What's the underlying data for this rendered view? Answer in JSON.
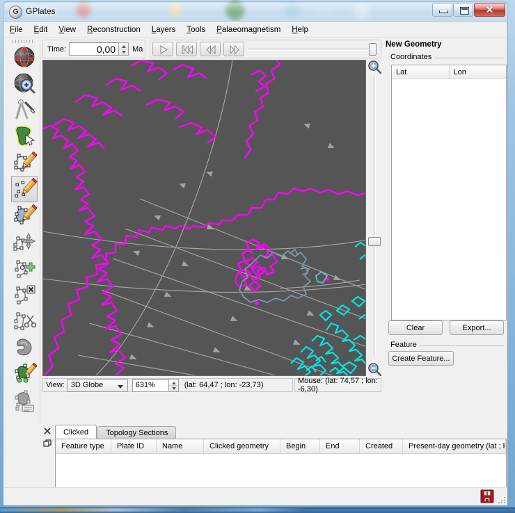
{
  "window": {
    "title": "GPlates",
    "app_icon": "gplates-globe-icon",
    "buttons": {
      "minimize": "minimize-icon",
      "maximize": "maximize-icon",
      "close": "close-icon"
    }
  },
  "menubar": {
    "items": [
      {
        "label": "File",
        "mnemonic": "F"
      },
      {
        "label": "Edit",
        "mnemonic": "E"
      },
      {
        "label": "View",
        "mnemonic": "V"
      },
      {
        "label": "Reconstruction",
        "mnemonic": "R"
      },
      {
        "label": "Layers",
        "mnemonic": "L"
      },
      {
        "label": "Tools",
        "mnemonic": "T"
      },
      {
        "label": "Palaeomagnetism",
        "mnemonic": "P"
      },
      {
        "label": "Help",
        "mnemonic": "H"
      }
    ]
  },
  "toolbar": {
    "time_label": "Time:",
    "time_value": "0,00",
    "time_unit": "Ma",
    "spin_up": "spinner-up-icon",
    "spin_down": "spinner-down-icon",
    "playback": [
      {
        "name": "play-button",
        "icon": "play-icon"
      },
      {
        "name": "reset-to-start-button",
        "icon": "skip-to-start-icon"
      },
      {
        "name": "step-back-button",
        "icon": "rewind-icon"
      },
      {
        "name": "step-forward-button",
        "icon": "fast-forward-icon"
      }
    ],
    "time_slider_position_percent": 100
  },
  "tools": {
    "selected_index": 5,
    "items": [
      {
        "name": "drag-globe-tool",
        "icon": "globe-drag-icon",
        "label": "Drag Globe"
      },
      {
        "name": "zoom-globe-tool",
        "icon": "globe-magnifier-icon",
        "label": "Zoom Globe"
      },
      {
        "name": "measure-distance-tool",
        "icon": "compass-divider-icon",
        "label": "Measure Distance"
      },
      {
        "name": "click-geometry-tool",
        "icon": "africa-cursor-icon",
        "label": "Click Geometry"
      },
      {
        "name": "digitise-polyline-tool",
        "icon": "polyline-pencil-icon",
        "label": "Digitise New Polyline Geometry"
      },
      {
        "name": "digitise-multipoint-tool",
        "icon": "multipoint-pencil-icon",
        "label": "Digitise New Multi-Point Geometry"
      },
      {
        "name": "digitise-polygon-tool",
        "icon": "polygon-pencil-icon",
        "label": "Digitise New Polygon Geometry"
      },
      {
        "name": "move-vertex-tool",
        "icon": "move-vertex-icon",
        "label": "Move Vertex"
      },
      {
        "name": "insert-vertex-tool",
        "icon": "insert-vertex-icon",
        "label": "Insert Vertex"
      },
      {
        "name": "delete-vertex-tool",
        "icon": "delete-vertex-icon",
        "label": "Delete Vertex"
      },
      {
        "name": "split-feature-tool",
        "icon": "split-scissors-icon",
        "label": "Split Feature"
      },
      {
        "name": "manipulate-pole-tool",
        "icon": "manipulate-pole-icon",
        "label": "Manipulate Pole"
      },
      {
        "name": "build-topology-tool",
        "icon": "build-topology-icon",
        "label": "Build New Topology"
      },
      {
        "name": "edit-topology-tool",
        "icon": "edit-topology-icon",
        "label": "Edit Topology Sections"
      }
    ]
  },
  "globe": {
    "background_color": "#555555",
    "coastline_color_magenta": "#ff00ff",
    "coastline_color_cyan": "#00e5e5",
    "iceland_outline_color": "#7d95aa",
    "grid_color": "#b4b4b4",
    "velocity_arrow_color": "#9a9a9a",
    "zoom_in_icon": "zoom-in-magnifier-icon",
    "zoom_out_icon": "zoom-out-magnifier-icon",
    "zoom_slider_position_percent": 58
  },
  "viewstatus": {
    "view_label": "View:",
    "view_mode": "3D Globe",
    "zoom_percent": "631%",
    "camera_position": "(lat: 64,47 ; lon: -23,73)",
    "mouse_position": "Mouse: (lat: 74,57 ; lon: -6,30)"
  },
  "rightdock": {
    "title": "New Geometry",
    "coordinates_group_label": "Coordinates",
    "table": {
      "columns": [
        "Lat",
        "Lon"
      ],
      "rows": []
    },
    "clear_button": "Clear",
    "export_button": "Export...",
    "feature_group_label": "Feature",
    "create_feature_button": "Create Feature..."
  },
  "bottomdock": {
    "close_icon": "close-icon",
    "float_icon": "undock-icon",
    "tabs": [
      {
        "label": "Clicked",
        "active": true
      },
      {
        "label": "Topology Sections",
        "active": false
      }
    ],
    "table": {
      "columns": [
        "Feature type",
        "Plate ID",
        "Name",
        "Clicked geometry",
        "Begin",
        "End",
        "Created",
        "Present-day geometry (lat ; lo"
      ],
      "rows": []
    },
    "scroll_left_icon": "scroll-left-arrow-icon",
    "scroll_right_icon": "scroll-right-arrow-icon"
  },
  "statusbar": {
    "unsaved_icon": "unsaved-changes-floppy-icon",
    "resize_grip": "resize-grip-icon"
  }
}
